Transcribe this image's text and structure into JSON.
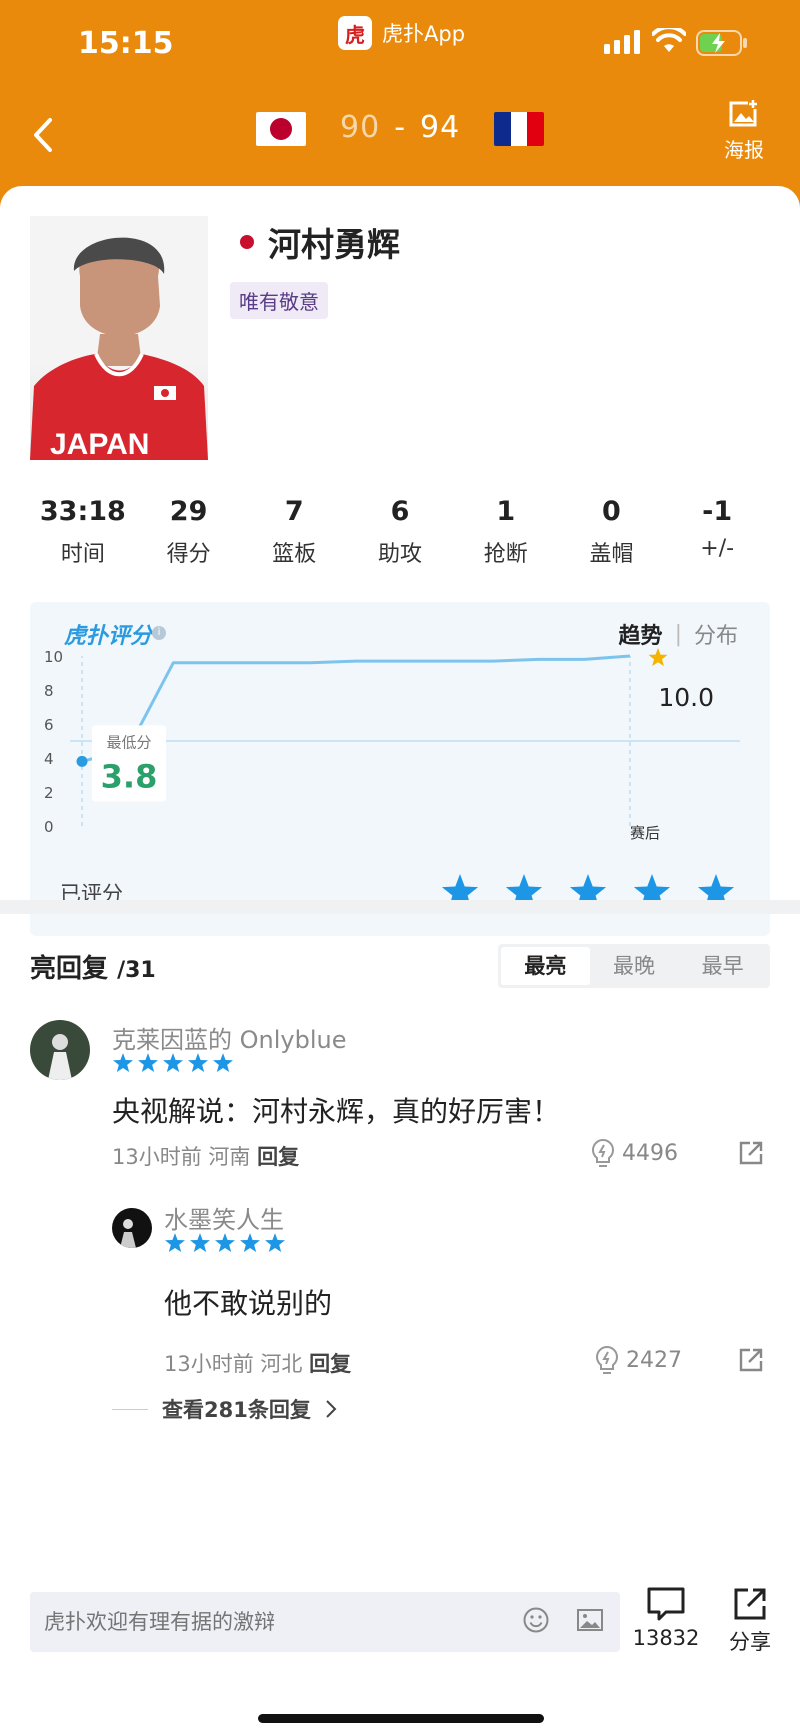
{
  "status_bar": {
    "time": "15:15",
    "app_name": "虎扑App",
    "app_logo": "虎扑"
  },
  "header": {
    "home_team": "Japan",
    "away_team": "France",
    "home_score": "90",
    "away_score": "94",
    "score_sep": "-",
    "poster_label": "海报"
  },
  "player": {
    "name": "河村勇辉",
    "tag": "唯有敬意",
    "photo_text": "JAPAN"
  },
  "stats": [
    {
      "value": "33:18",
      "label": "时间"
    },
    {
      "value": "29",
      "label": "得分"
    },
    {
      "value": "7",
      "label": "篮板"
    },
    {
      "value": "6",
      "label": "助攻"
    },
    {
      "value": "1",
      "label": "抢断"
    },
    {
      "value": "0",
      "label": "盖帽"
    },
    {
      "value": "-1",
      "label": "+/-"
    }
  ],
  "rating": {
    "brand": "虎扑评分",
    "tab_active": "趋势",
    "tab_inactive": "分布",
    "min_label": "最低分",
    "min_value": "3.8",
    "final_value": "10.0",
    "after_label": "赛后",
    "rated_label": "已评分",
    "user_stars": 5
  },
  "chart_data": {
    "type": "line",
    "ylim": [
      0,
      10
    ],
    "yticks": [
      "0",
      "2",
      "4",
      "6",
      "8",
      "10"
    ],
    "x": [
      0,
      1,
      2,
      3,
      4,
      5,
      6,
      7,
      8,
      9,
      10,
      11,
      12
    ],
    "series": [
      {
        "values": [
          3.8,
          4.5,
          9.6,
          9.6,
          9.6,
          9.6,
          9.7,
          9.7,
          9.7,
          9.7,
          9.8,
          9.8,
          10.0
        ]
      }
    ],
    "reference_line": 5,
    "xlabel_end": "赛后"
  },
  "comments": {
    "title": "亮回复",
    "count": "/31",
    "sort_tabs": [
      "最亮",
      "最晚",
      "最早"
    ],
    "items": [
      {
        "user": "克莱因蓝的 Onlyblue",
        "stars": 5,
        "text": "央视解说：河村永辉，真的好厉害！",
        "time": "13小时前",
        "region": "河南",
        "reply": "回复",
        "likes": "4496"
      },
      {
        "user": "水墨笑人生",
        "stars": 5,
        "text": "他不敢说别的",
        "time": "13小时前",
        "region": "河北",
        "reply": "回复",
        "likes": "2427"
      }
    ],
    "view_replies": "查看281条回复"
  },
  "bottom": {
    "placeholder": "虎扑欢迎有理有据的激辩",
    "comment_count": "13832",
    "share_label": "分享"
  },
  "colors": {
    "brand_orange": "#e98a0c",
    "rating_blue": "#2a9be0",
    "star_blue": "#1e96e6"
  }
}
